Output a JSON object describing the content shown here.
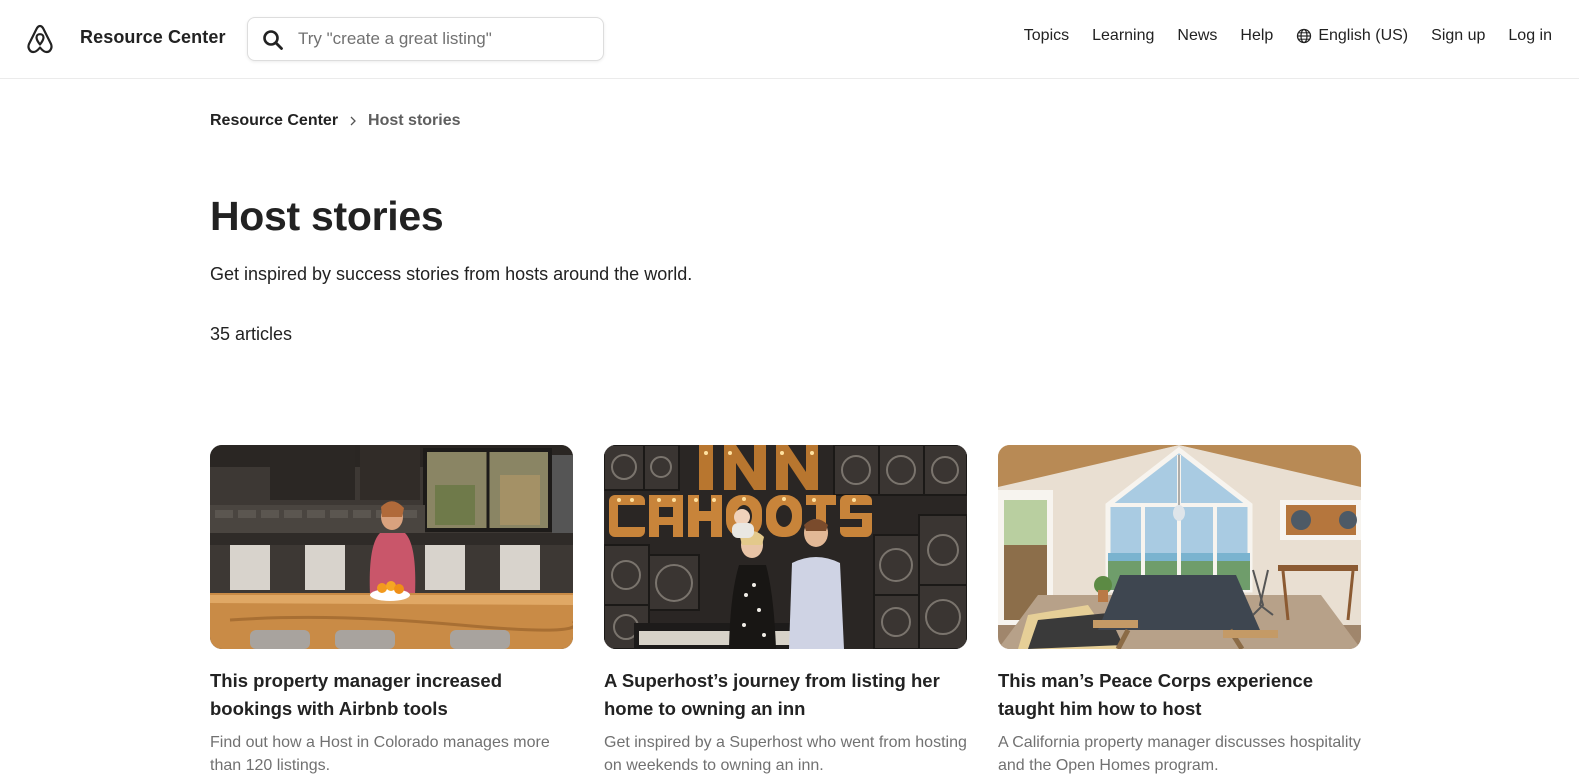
{
  "header": {
    "brand": "Resource Center",
    "search_placeholder": "Try \"create a great listing\"",
    "nav": {
      "topics": "Topics",
      "learning": "Learning",
      "news": "News",
      "help": "Help",
      "language": "English (US)",
      "signup": "Sign up",
      "login": "Log in"
    }
  },
  "breadcrumb": {
    "home": "Resource Center",
    "current": "Host stories"
  },
  "page": {
    "title": "Host stories",
    "subtitle": "Get inspired by success stories from hosts around the world.",
    "count": "35 articles"
  },
  "cards": [
    {
      "title": "This property manager increased bookings with Airbnb tools",
      "description": "Find out how a Host in Colorado manages more than 120 listings."
    },
    {
      "title": "A Superhost’s journey from listing her home to owning an inn",
      "description": "Get inspired by a Superhost who went from hosting on weekends to owning an inn."
    },
    {
      "title": "This man’s Peace Corps experience taught him how to host",
      "description": "A California property manager discusses hospitality and the Open Homes program."
    }
  ],
  "colors": {
    "text": "#222222",
    "muted": "#717171",
    "border": "#dddddd"
  }
}
